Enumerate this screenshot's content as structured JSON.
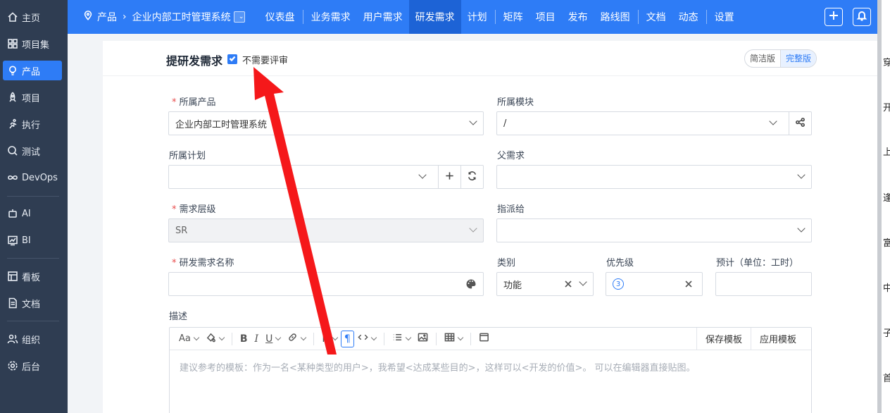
{
  "sidebar": {
    "items": [
      {
        "label": "主页",
        "icon": "home-icon"
      },
      {
        "label": "项目集",
        "icon": "grid-icon"
      },
      {
        "label": "产品",
        "icon": "lightbulb-icon"
      },
      {
        "label": "项目",
        "icon": "rocket-icon"
      },
      {
        "label": "执行",
        "icon": "run-icon"
      },
      {
        "label": "测试",
        "icon": "search-icon"
      },
      {
        "label": "DevOps",
        "icon": "infinity-icon"
      },
      {
        "label": "AI",
        "icon": "robot-icon"
      },
      {
        "label": "BI",
        "icon": "chart-icon"
      },
      {
        "label": "看板",
        "icon": "kanban-icon"
      },
      {
        "label": "文档",
        "icon": "document-icon"
      },
      {
        "label": "组织",
        "icon": "people-icon"
      },
      {
        "label": "后台",
        "icon": "gear-icon"
      }
    ]
  },
  "header": {
    "crumb_root": "产品",
    "crumb_product": "企业内部工时管理系统",
    "nav": [
      "仪表盘",
      "业务需求",
      "用户需求",
      "研发需求",
      "计划",
      "矩阵",
      "项目",
      "发布",
      "路线图",
      "文档",
      "动态",
      "设置"
    ]
  },
  "form": {
    "title": "提研发需求",
    "no_review_label": "不需要评审",
    "mode_simple": "简洁版",
    "mode_full": "完整版",
    "product_label": "所属产品",
    "product_value": "企业内部工时管理系统",
    "module_label": "所属模块",
    "module_value": "/",
    "plan_label": "所属计划",
    "parent_label": "父需求",
    "level_label": "需求层级",
    "level_value": "SR",
    "assign_label": "指派给",
    "name_label": "研发需求名称",
    "category_label": "类别",
    "category_value": "功能",
    "priority_label": "优先级",
    "priority_value": "3",
    "estimate_label": "预计（单位：工时）",
    "desc_label": "描述",
    "editor_placeholder": "建议参考的模板：作为一名<某种类型的用户>，我希望<达成某些目的>，这样可以<开发的价值>。 可以在编辑器直接贴图。",
    "save_template": "保存模板",
    "apply_template": "应用模板"
  },
  "right_strip": [
    "穿",
    "开",
    "上",
    "逢",
    "富",
    "中",
    "子",
    "首"
  ],
  "colors": {
    "accent": "#2e7cf6",
    "sidebar": "#2f3d52",
    "arrow": "#f5181a"
  }
}
